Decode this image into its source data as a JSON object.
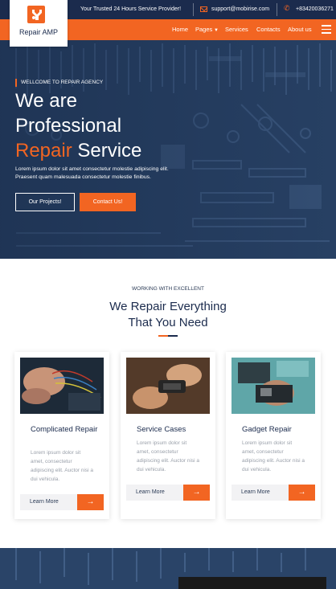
{
  "topbar": {
    "tagline": "Your Trusted 24 Hours Service Provider!",
    "email": "support@mobirise.com",
    "phone": "+83420036271"
  },
  "brand": {
    "name": "Repair AMP"
  },
  "nav": {
    "items": [
      {
        "label": "Home"
      },
      {
        "label": "Pages"
      },
      {
        "label": "Services"
      },
      {
        "label": "Contacts"
      },
      {
        "label": "About us"
      }
    ]
  },
  "hero": {
    "eyebrow": "WELLCOME TO REPAIR AGENCY",
    "title_line1": "We are",
    "title_line2": "Professional",
    "title_highlight": "Repair",
    "title_rest": "Service",
    "description": "Lorem ipsum dolor sit amet consectetur molestie adipiscing elit. Praesent quam malesuada consectetur molestie finibus.",
    "btn_projects": "Our Projects!",
    "btn_contact": "Contact Us!"
  },
  "services": {
    "kicker": "WORKING WITH EXCELLENT",
    "title_line1": "We Repair Everything",
    "title_line2": "That You Need",
    "cards": [
      {
        "title": "Complicated Repair",
        "text": "Lorem ipsum dolor sit amet, consectetur adipiscing elit. Auctor nisi a dui vehicula.",
        "button": "Learn More"
      },
      {
        "title": "Service Cases",
        "text": "Lorem ipsum dolor sit amet, consectetur adipiscing elit. Auctor nisi a dui vehicula.",
        "button": "Learn More"
      },
      {
        "title": "Gadget Repair",
        "text": "Lorem ipsum dolor sit amet, consectetur adipiscing elit. Auctor nisi a dui vehicula.",
        "button": "Learn More"
      }
    ]
  },
  "colors": {
    "accent": "#f26522",
    "navy": "#1b2b4d",
    "hero_bg": "#233a5e"
  }
}
